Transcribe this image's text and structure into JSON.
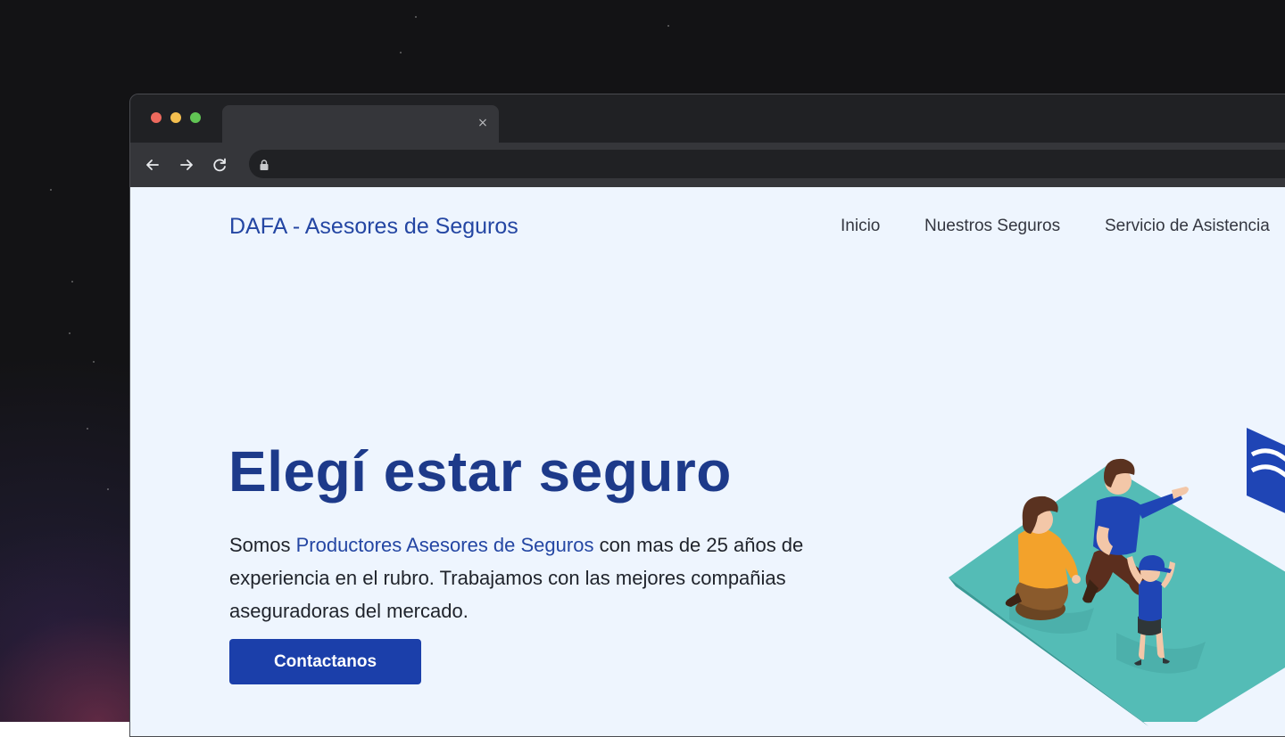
{
  "browser": {
    "tab_close": "×"
  },
  "site": {
    "brand": "DAFA - Asesores de Seguros",
    "nav": [
      {
        "label": "Inicio"
      },
      {
        "label": "Nuestros Seguros"
      },
      {
        "label": "Servicio de Asistencia"
      }
    ]
  },
  "hero": {
    "title": "Elegí estar seguro",
    "text_before": "Somos ",
    "text_highlight": "Productores Asesores de Seguros",
    "text_after": " con mas de 25 años de experiencia en el rubro. Trabajamos con las mejores compañias aseguradoras del mercado.",
    "cta": "Contactanos"
  },
  "colors": {
    "brand": "#2446a3",
    "cta": "#1b3faa",
    "page_bg": "#eef5fe",
    "browser_chrome": "#202124"
  },
  "icons": [
    "back-arrow-icon",
    "forward-arrow-icon",
    "reload-icon",
    "lock-icon",
    "close-icon"
  ]
}
